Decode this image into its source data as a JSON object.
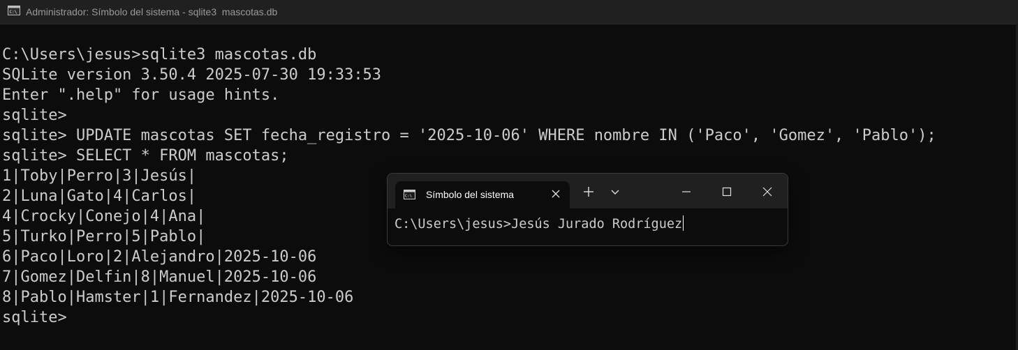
{
  "main_window": {
    "title": "Administrador: Símbolo del sistema - sqlite3  mascotas.db",
    "icon": "cmd-icon"
  },
  "console": {
    "lines": [
      "",
      "C:\\Users\\jesus>sqlite3 mascotas.db",
      "SQLite version 3.50.4 2025-07-30 19:33:53",
      "Enter \".help\" for usage hints.",
      "sqlite>",
      "sqlite> UPDATE mascotas SET fecha_registro = '2025-10-06' WHERE nombre IN ('Paco', 'Gomez', 'Pablo');",
      "sqlite> SELECT * FROM mascotas;",
      "1|Toby|Perro|3|Jesús|",
      "2|Luna|Gato|4|Carlos|",
      "4|Crocky|Conejo|4|Ana|",
      "5|Turko|Perro|5|Pablo|",
      "6|Paco|Loro|2|Alejandro|2025-10-06",
      "7|Gomez|Delfin|8|Manuel|2025-10-06",
      "8|Pablo|Hamster|1|Fernandez|2025-10-06",
      "sqlite>"
    ]
  },
  "terminal_window": {
    "tab": {
      "title": "Símbolo del sistema",
      "icon": "cmd-icon"
    },
    "buttons": {
      "new_tab": "plus-icon",
      "dropdown": "chevron-down-icon",
      "minimize": "minimize-icon",
      "maximize": "maximize-icon",
      "close": "close-icon"
    },
    "prompt_line": "C:\\Users\\jesus>Jesús Jurado Rodríguez"
  },
  "colors": {
    "console_background": "#0c0c0c",
    "console_text": "#cccccc",
    "titlebar_background": "#202020",
    "title_text": "#9a9a9a"
  }
}
